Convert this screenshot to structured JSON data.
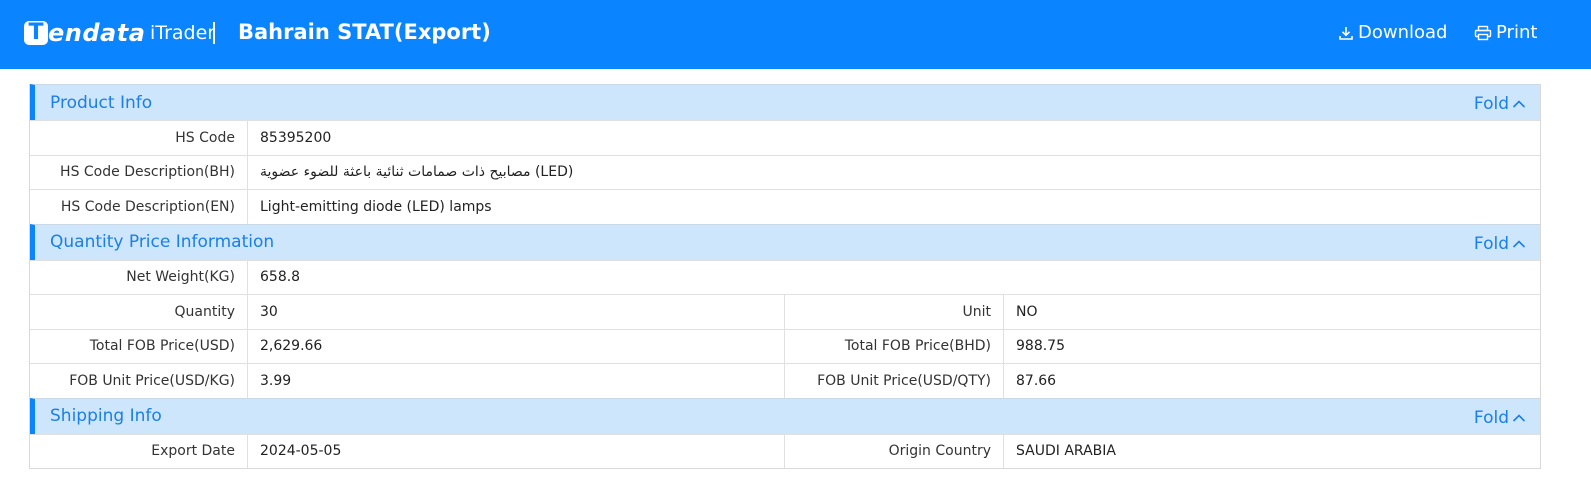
{
  "header": {
    "logo_mark": "T",
    "logo_text": "endata",
    "product": "iTrader",
    "title": "Bahrain STAT(Export)",
    "download_label": "Download",
    "print_label": "Print",
    "brand_color": "#0a84ff"
  },
  "sections": {
    "product": {
      "title": "Product Info",
      "fold_label": "Fold",
      "rows": [
        {
          "label": "HS Code",
          "value": "85395200"
        },
        {
          "label": "HS Code Description(BH)",
          "value": "مصابيح ذات صمامات ثنائية باعثة للضوء عضوية (LED)"
        },
        {
          "label": "HS Code Description(EN)",
          "value": "Light-emitting diode (LED) lamps"
        }
      ]
    },
    "quantity": {
      "title": "Quantity Price Information",
      "fold_label": "Fold",
      "net_weight": {
        "label": "Net Weight(KG)",
        "value": "658.8"
      },
      "quantity": {
        "label": "Quantity",
        "value": "30"
      },
      "unit": {
        "label": "Unit",
        "value": "NO"
      },
      "fob_usd": {
        "label": "Total FOB Price(USD)",
        "value": "2,629.66"
      },
      "fob_bhd": {
        "label": "Total FOB Price(BHD)",
        "value": "988.75"
      },
      "unit_kg": {
        "label": "FOB Unit Price(USD/KG)",
        "value": "3.99"
      },
      "unit_qty": {
        "label": "FOB Unit Price(USD/QTY)",
        "value": "87.66"
      }
    },
    "shipping": {
      "title": "Shipping Info",
      "fold_label": "Fold",
      "export_date": {
        "label": "Export Date",
        "value": "2024-05-05"
      },
      "origin": {
        "label": "Origin Country",
        "value": "SAUDI ARABIA"
      }
    }
  }
}
